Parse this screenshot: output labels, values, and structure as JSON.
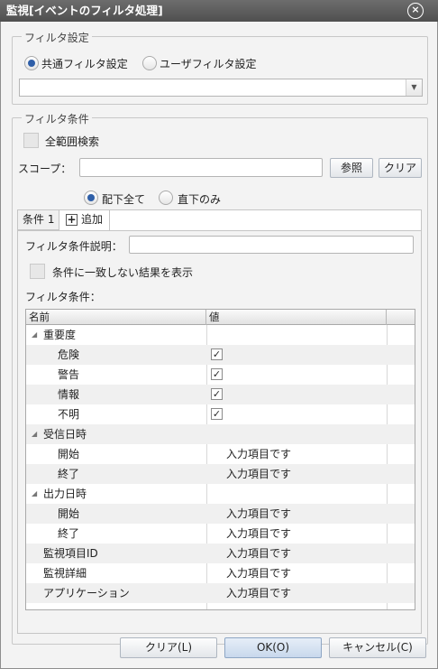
{
  "window": {
    "title": "監視[イベントのフィルタ処理]",
    "close_glyph": "×"
  },
  "filter_settings": {
    "legend": "フィルタ設定",
    "option_common": "共通フィルタ設定",
    "option_user": "ユーザフィルタ設定",
    "selected": "common",
    "select_value": ""
  },
  "filter_conditions": {
    "legend": "フィルタ条件",
    "all_range_search": "全範囲検索",
    "scope_label": "スコープ：",
    "scope_value": "",
    "browse_button": "参照",
    "clear_button": "クリア",
    "scope_all": "配下全て",
    "scope_direct": "直下のみ",
    "scope_selected": "all"
  },
  "tabs": {
    "active_tab": "条件 1",
    "add_tab": "追加"
  },
  "condition": {
    "description_label": "フィルタ条件説明：",
    "description_value": "",
    "show_nonmatching": "条件に一致しない結果を表示",
    "conditions_label": "フィルタ条件："
  },
  "grid": {
    "columns": [
      "名前",
      "値"
    ],
    "rows": [
      {
        "name": "重要度",
        "level": 0,
        "expandable": true,
        "value": ""
      },
      {
        "name": "危険",
        "level": 1,
        "checked": true
      },
      {
        "name": "警告",
        "level": 1,
        "checked": true
      },
      {
        "name": "情報",
        "level": 1,
        "checked": true
      },
      {
        "name": "不明",
        "level": 1,
        "checked": true
      },
      {
        "name": "受信日時",
        "level": 0,
        "expandable": true,
        "value": ""
      },
      {
        "name": "開始",
        "level": 1,
        "value": "入力項目です"
      },
      {
        "name": "終了",
        "level": 1,
        "value": "入力項目です"
      },
      {
        "name": "出力日時",
        "level": 0,
        "expandable": true,
        "value": ""
      },
      {
        "name": "開始",
        "level": 1,
        "value": "入力項目です"
      },
      {
        "name": "終了",
        "level": 1,
        "value": "入力項目です"
      },
      {
        "name": "監視項目ID",
        "level": 0,
        "value": "入力項目です"
      },
      {
        "name": "監視詳細",
        "level": 0,
        "value": "入力項目です"
      },
      {
        "name": "アプリケーション",
        "level": 0,
        "value": "入力項目です"
      }
    ]
  },
  "footer": {
    "clear": "クリア(L)",
    "ok": "OK(O)",
    "cancel": "キャンセル(C)"
  }
}
